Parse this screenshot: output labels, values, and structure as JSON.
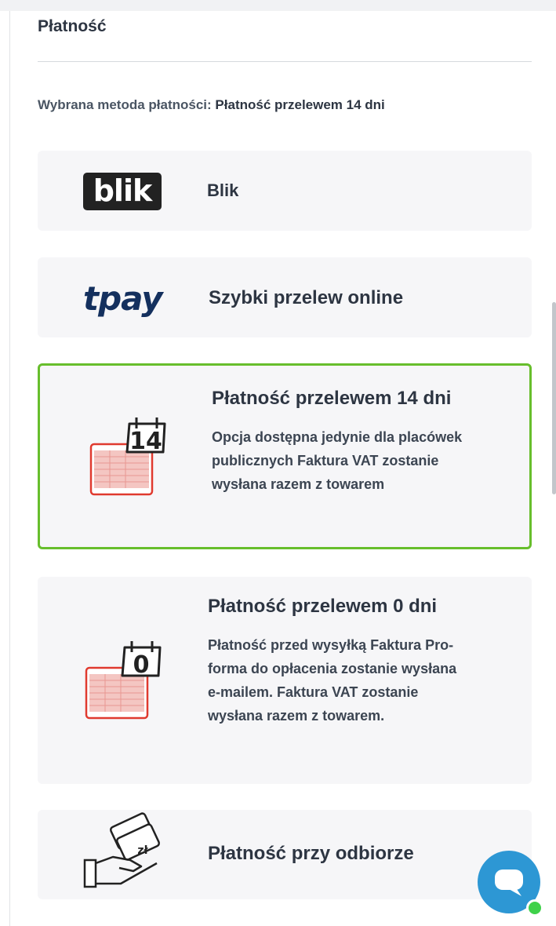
{
  "panel": {
    "title": "Płatność",
    "selected_label": "Wybrana metoda płatności:",
    "selected_value": "Płatność przelewem 14 dni"
  },
  "methods": [
    {
      "logo_text": "blik",
      "title": "Blik"
    },
    {
      "logo_text": "tpay",
      "title": "Szybki przelew online"
    },
    {
      "title": "Płatność przelewem 14 dni",
      "badge": "14",
      "description": [
        "Opcja dostępna jedynie dla placówek",
        "publicznych Faktura VAT zostanie",
        "wysłana razem z towarem"
      ]
    },
    {
      "title": "Płatność przelewem 0 dni",
      "badge": "0",
      "description": [
        "Płatność przed wysyłką Faktura Pro-",
        "forma do opłacenia zostanie wysłana",
        "e-mailem. Faktura VAT zostanie",
        "wysłana razem z towarem."
      ]
    },
    {
      "title": "Płatność przy odbiorze",
      "badge": "zł"
    }
  ],
  "colors": {
    "accent": "#67be2c",
    "card_bg": "#f6f6f8",
    "invoice_red": "#e03a2f",
    "chat": "#2d97d4",
    "online": "#3fd14a"
  },
  "icons": [
    "blik-logo",
    "tpay-logo",
    "invoice-14-icon",
    "invoice-0-icon",
    "cash-hand-icon",
    "chat-icon"
  ]
}
